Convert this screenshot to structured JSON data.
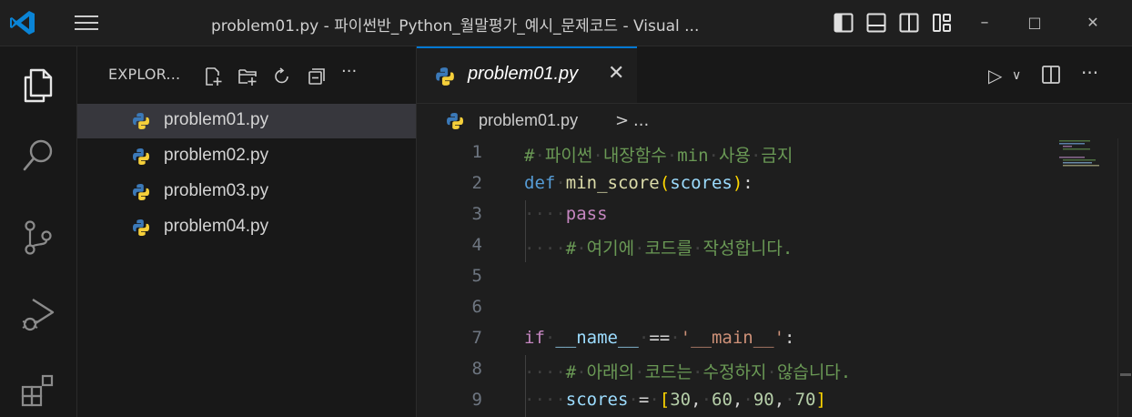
{
  "window": {
    "title": "problem01.py - 파이썬반_Python_월말평가_예시_문제코드 - Visual ...",
    "minimize_label": "–",
    "maximize_label": "□",
    "close_label": "✕"
  },
  "activity_bar": {
    "items": [
      {
        "name": "explorer",
        "icon": "files-icon"
      },
      {
        "name": "search",
        "icon": "search-icon"
      },
      {
        "name": "source-control",
        "icon": "source-control-icon"
      },
      {
        "name": "run-debug",
        "icon": "run-debug-icon"
      },
      {
        "name": "extensions",
        "icon": "extensions-icon"
      }
    ]
  },
  "sidebar": {
    "title": "EXPLOR...",
    "more_label": "···",
    "files": [
      {
        "name": "problem01.py",
        "active": true
      },
      {
        "name": "problem02.py",
        "active": false
      },
      {
        "name": "problem03.py",
        "active": false
      },
      {
        "name": "problem04.py",
        "active": false
      }
    ]
  },
  "editor": {
    "tab_label": "problem01.py",
    "tab_close": "✕",
    "run_label": "▷",
    "run_dropdown": "∨",
    "more_label": "···",
    "breadcrumb": {
      "file": "problem01.py",
      "separator": ">",
      "more": "..."
    },
    "line_numbers": [
      "1",
      "2",
      "3",
      "4",
      "5",
      "6",
      "7",
      "8",
      "9"
    ]
  },
  "colors": {
    "accent": "#0078d4",
    "python_blue": "#3776ab",
    "python_yellow": "#ffd43b",
    "comment": "#6a9955",
    "keyword": "#569cd6"
  }
}
